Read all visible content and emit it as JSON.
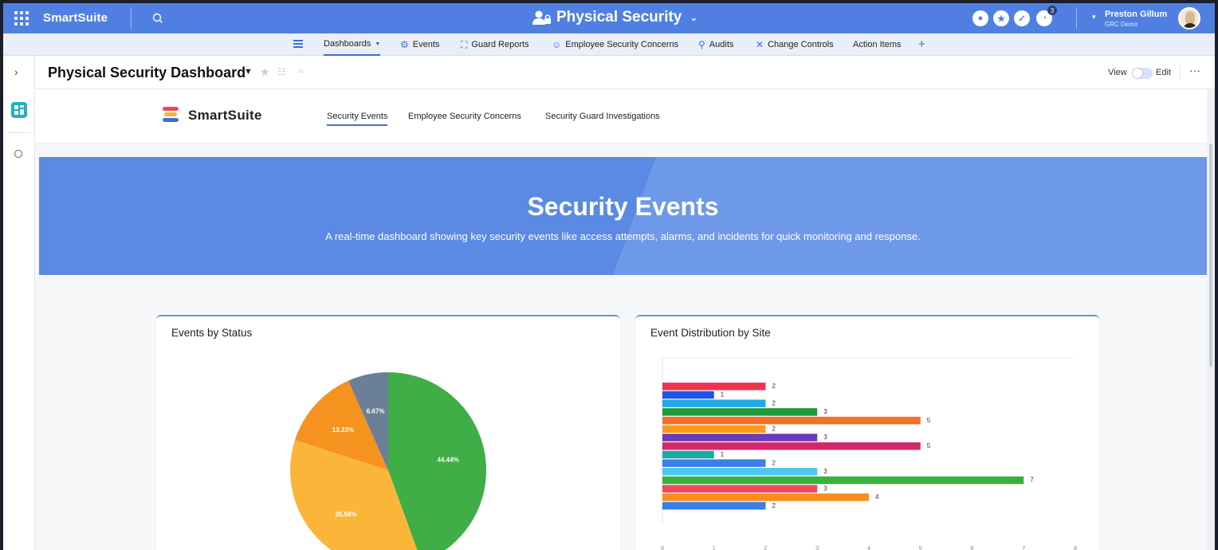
{
  "topbar": {
    "brand": "SmartSuite",
    "workspace_title": "Physical Security",
    "notification_count": "3",
    "user_name": "Preston Gillum",
    "user_org": "GRC Demo"
  },
  "nav": {
    "items": [
      {
        "label": "Dashboards",
        "icon": "chevron-down-icon"
      },
      {
        "label": "Events",
        "icon": "events-icon"
      },
      {
        "label": "Guard Reports",
        "icon": "guard-reports-icon"
      },
      {
        "label": "Employee Security Concerns",
        "icon": "employee-concerns-icon"
      },
      {
        "label": "Audits",
        "icon": "audits-icon"
      },
      {
        "label": "Change Controls",
        "icon": "tools-icon"
      },
      {
        "label": "Action Items",
        "icon": ""
      }
    ]
  },
  "page": {
    "title": "Physical Security Dashboard",
    "view_label": "View",
    "edit_label": "Edit"
  },
  "dashboard": {
    "logo_text": "SmartSuite",
    "tabs": [
      {
        "label": "Security Events"
      },
      {
        "label": "Employee Security Concerns"
      },
      {
        "label": "Security Guard Investigations"
      }
    ],
    "hero_title": "Security Events",
    "hero_description": "A real-time dashboard showing key security events like access attempts, alarms, and incidents for quick monitoring and response."
  },
  "colors": {
    "accent": "#4f80e1",
    "hero": "#5a8ae3"
  },
  "chart_data": [
    {
      "type": "pie",
      "title": "Events by Status",
      "slices": [
        {
          "value": 44.44,
          "label": "44.44%",
          "color": "#3fae46"
        },
        {
          "value": 35.56,
          "label": "35.56%",
          "color": "#fbb63a"
        },
        {
          "value": 13.33,
          "label": "13.33%",
          "color": "#f6921e"
        },
        {
          "value": 6.67,
          "label": "6.67%",
          "color": "#6b7f99"
        }
      ]
    },
    {
      "type": "bar",
      "orientation": "horizontal",
      "title": "Event Distribution by Site",
      "values": [
        2,
        1,
        2,
        3,
        5,
        2,
        3,
        5,
        1,
        2,
        3,
        7,
        3,
        4,
        2
      ],
      "colors": [
        "#f0344e",
        "#1e55e6",
        "#22a8e6",
        "#1f9a3b",
        "#f4702a",
        "#fb9b1a",
        "#6a3bb6",
        "#d4266a",
        "#17aaa0",
        "#3a7fe6",
        "#4ec7f0",
        "#38b13c",
        "#f0485a",
        "#fb8c1e",
        "#3a7fe6"
      ],
      "xlim": [
        0,
        8
      ],
      "xticks": [
        "0",
        "1",
        "2",
        "3",
        "4",
        "5",
        "6",
        "7",
        "8"
      ]
    }
  ]
}
